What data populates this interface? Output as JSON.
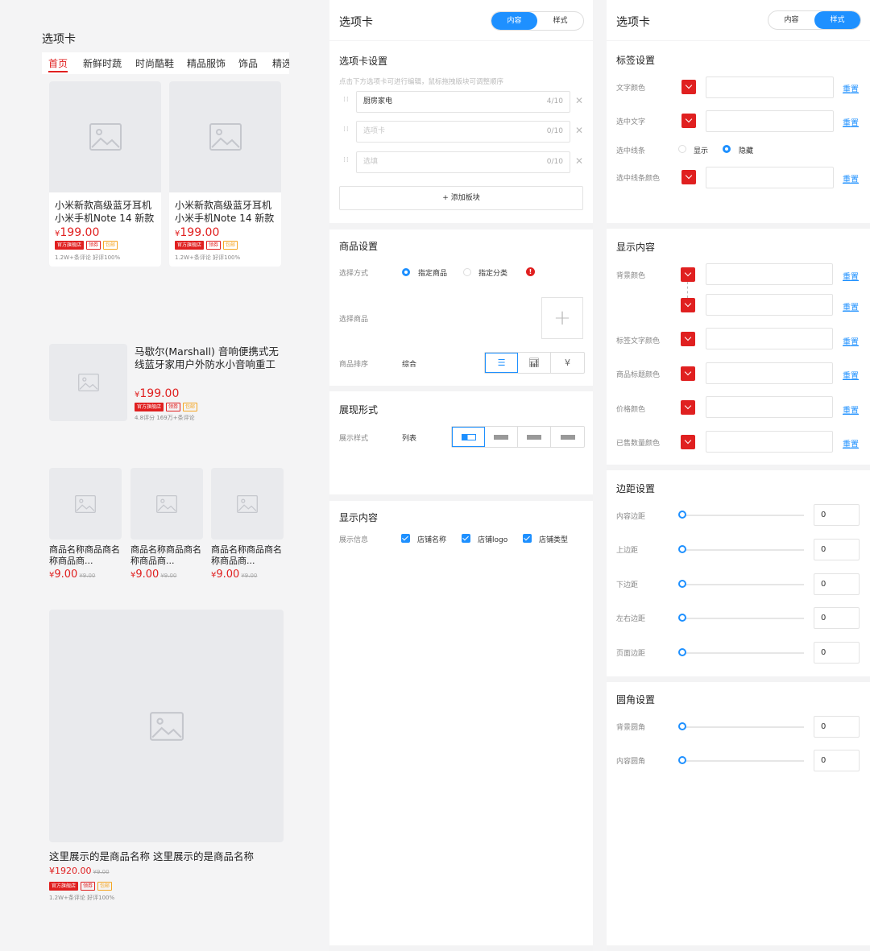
{
  "preview": {
    "title": "选项卡",
    "tabs": [
      "首页",
      "新鲜时蔬",
      "时尚酷鞋",
      "精品服饰",
      "饰品",
      "精选"
    ],
    "products_grid2": [
      {
        "name": "小米新款高级蓝牙耳机小米手机Note 14 新款上...",
        "price": "199.00",
        "currency": "¥",
        "tags": [
          "官方旗舰店",
          "领券",
          "包邮"
        ],
        "meta": "1.2W+条评论  好评100%"
      },
      {
        "name": "小米新款高级蓝牙耳机小米手机Note 14 新款上...",
        "price": "199.00",
        "currency": "¥",
        "tags": [
          "官方旗舰店",
          "领券",
          "包邮"
        ],
        "meta": "1.2W+条评论  好评100%"
      }
    ],
    "product_list": {
      "name": "马歇尔(Marshall) 音响便携式无线蓝牙家用户外防水小音响重工设...",
      "price": "199.00",
      "currency": "¥",
      "tags": [
        "官方旗舰店",
        "领券",
        "包邮"
      ],
      "meta": "4.8评分 169万+条评论"
    },
    "products_grid3": [
      {
        "name": "商品名称商品商名称商品商...",
        "price": "9.00",
        "old": "¥9.00",
        "currency": "¥"
      },
      {
        "name": "商品名称商品商名称商品商...",
        "price": "9.00",
        "old": "¥9.00",
        "currency": "¥"
      },
      {
        "name": "商品名称商品商名称商品商...",
        "price": "9.00",
        "old": "¥9.00",
        "currency": "¥"
      }
    ],
    "product_big": {
      "name": "这里展示的是商品名称 这里展示的是商品名称",
      "price": "¥1920.00",
      "old": "¥9.00",
      "tags": [
        "官方旗舰店",
        "领券",
        "包邮"
      ],
      "meta": "1.2W+条评论  好评100%"
    }
  },
  "content_panel": {
    "title": "选项卡",
    "seg": [
      "内容",
      "样式"
    ],
    "tab_settings": {
      "title": "选项卡设置",
      "hint": "点击下方选项卡可进行编辑，鼠标拖拽版块可调整顺序",
      "items": [
        {
          "value": "厨房家电",
          "placeholder": "",
          "count": "4/10"
        },
        {
          "value": "",
          "placeholder": "选项卡",
          "count": "0/10"
        },
        {
          "value": "",
          "placeholder": "选填",
          "count": "0/10"
        }
      ],
      "add_label": "+ 添加板块"
    },
    "goods_settings": {
      "title": "商品设置",
      "select_mode_label": "选择方式",
      "opt_specified": "指定商品",
      "opt_category": "指定分类",
      "select_goods_label": "选择商品",
      "sort_label": "商品排序",
      "sort_value": "综合"
    },
    "display_form": {
      "title": "展现形式",
      "style_label": "展示样式",
      "style_value": "列表"
    },
    "display_content": {
      "title": "显示内容",
      "info_label": "展示信息",
      "options": [
        "店铺名称",
        "店铺logo",
        "店铺类型"
      ]
    }
  },
  "style_panel": {
    "title": "选项卡",
    "seg": [
      "内容",
      "样式"
    ],
    "reset": "重置",
    "tag_settings": {
      "title": "标签设置",
      "text_color": "文字颜色",
      "selected_text": "选中文字",
      "selected_line": "选中线条",
      "show": "显示",
      "hide": "隐藏",
      "line_color": "选中线条颜色"
    },
    "display_content": {
      "title": "显示内容",
      "bg_color": "背景颜色",
      "tag_text_color": "标签文字颜色",
      "goods_title_color": "商品标题颜色",
      "price_color": "价格颜色",
      "sold_color": "已售数量颜色"
    },
    "margin": {
      "title": "边距设置",
      "items": [
        {
          "label": "内容边距",
          "value": "0"
        },
        {
          "label": "上边距",
          "value": "0"
        },
        {
          "label": "下边距",
          "value": "0"
        },
        {
          "label": "左右边距",
          "value": "0"
        },
        {
          "label": "页面边距",
          "value": "0"
        }
      ]
    },
    "radius": {
      "title": "圆角设置",
      "items": [
        {
          "label": "背景圆角",
          "value": "0"
        },
        {
          "label": "内容圆角",
          "value": "0"
        }
      ]
    }
  }
}
